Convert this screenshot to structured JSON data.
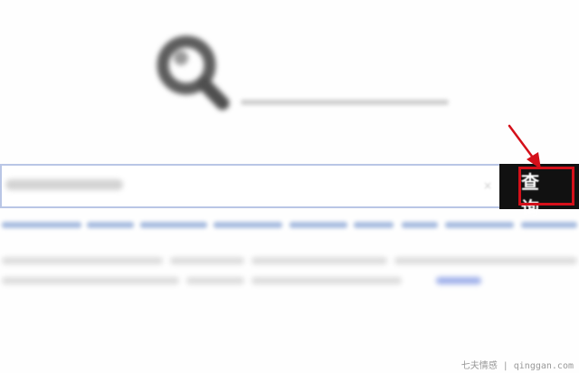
{
  "logo": {
    "title": "",
    "subtitle": ""
  },
  "search": {
    "input_value": "",
    "placeholder": "",
    "button_label": "查 询"
  },
  "quick_links": [],
  "annotation": {
    "highlight_color": "#d4101a"
  },
  "watermark": "七夫情感 | qinggan.com"
}
